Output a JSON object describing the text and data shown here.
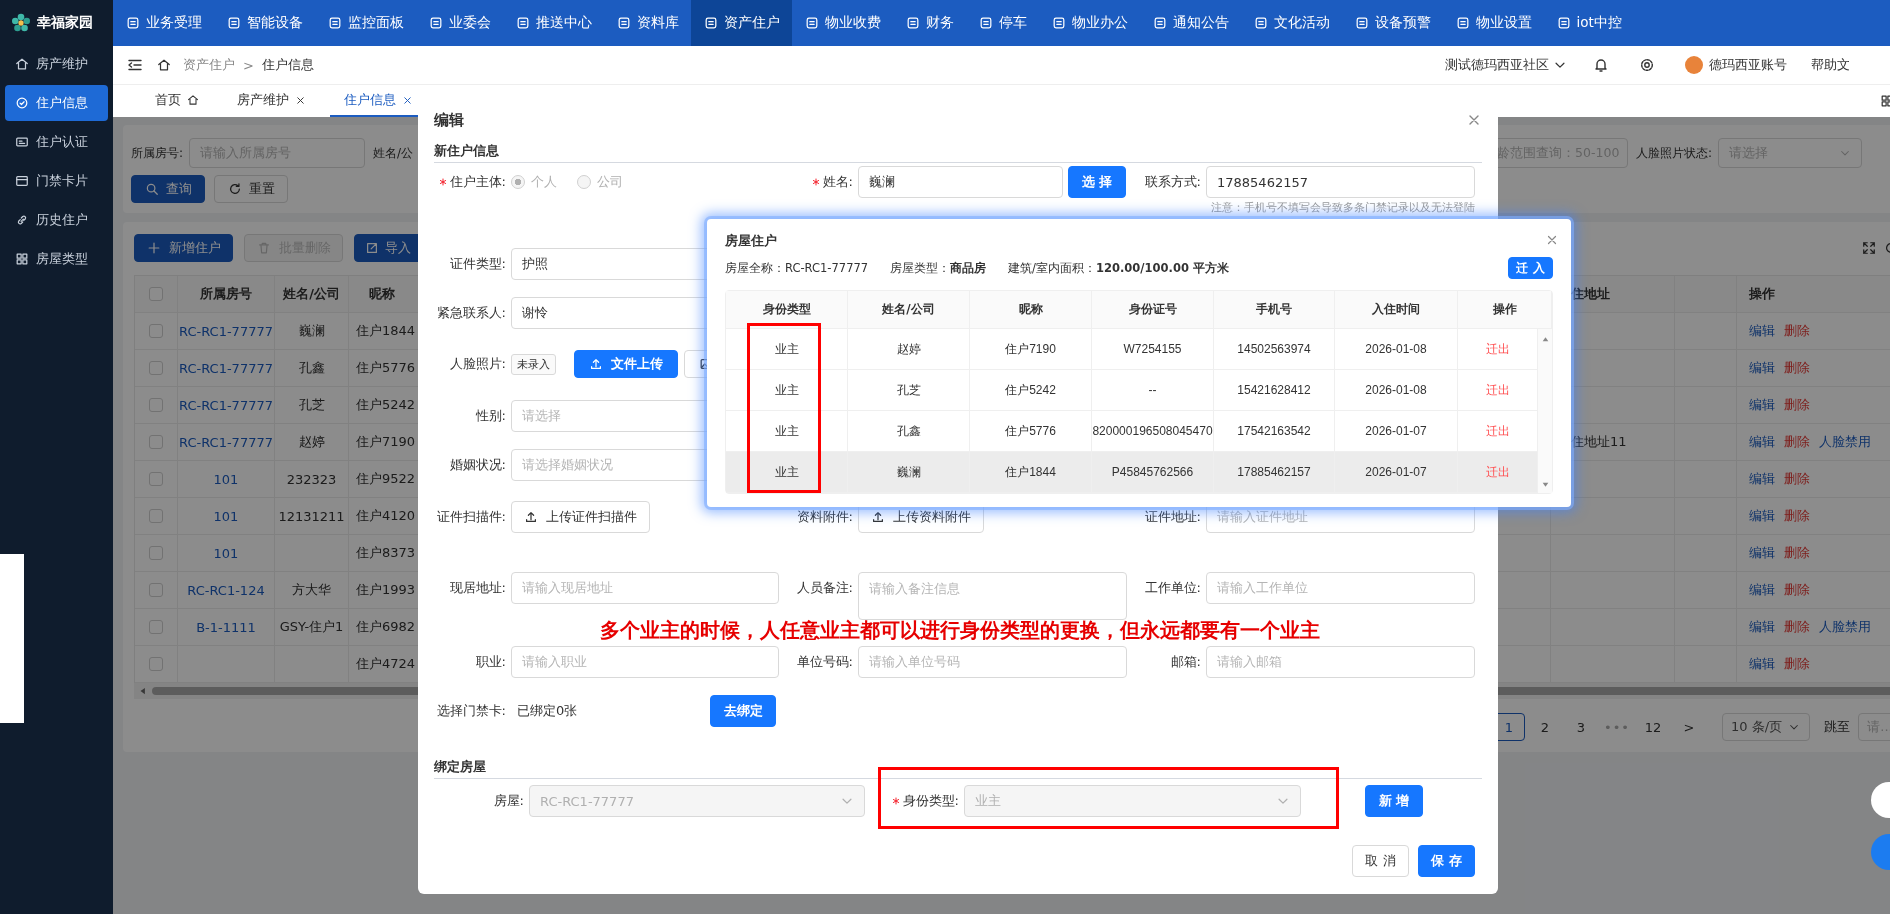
{
  "app": {
    "logo": "幸福家园"
  },
  "top_nav": [
    {
      "label": "业务受理",
      "selected": false
    },
    {
      "label": "智能设备",
      "selected": false
    },
    {
      "label": "监控面板",
      "selected": false
    },
    {
      "label": "业委会",
      "selected": false
    },
    {
      "label": "推送中心",
      "selected": false
    },
    {
      "label": "资料库",
      "selected": false
    },
    {
      "label": "资产住户",
      "selected": true
    },
    {
      "label": "物业收费",
      "selected": false
    },
    {
      "label": "财务",
      "selected": false
    },
    {
      "label": "停车",
      "selected": false
    },
    {
      "label": "物业办公",
      "selected": false
    },
    {
      "label": "通知公告",
      "selected": false
    },
    {
      "label": "文化活动",
      "selected": false
    },
    {
      "label": "设备预警",
      "selected": false
    },
    {
      "label": "物业设置",
      "selected": false
    },
    {
      "label": "iot中控",
      "selected": false
    }
  ],
  "sidebar": {
    "items": [
      {
        "label": "房产维护",
        "selected": false
      },
      {
        "label": "住户信息",
        "selected": true
      },
      {
        "label": "住户认证",
        "selected": false
      },
      {
        "label": "门禁卡片",
        "selected": false
      },
      {
        "label": "历史住户",
        "selected": false
      },
      {
        "label": "房屋类型",
        "selected": false
      }
    ]
  },
  "header": {
    "breadcrumb": [
      "资产住户",
      "住户信息"
    ],
    "separator": ">",
    "community": "测试德玛西亚社区",
    "user": "德玛西亚账号",
    "help": "帮助文"
  },
  "page_tabs": [
    {
      "label": "首页",
      "kind": "home",
      "selected": false
    },
    {
      "label": "房产维护",
      "kind": "closable",
      "selected": false
    },
    {
      "label": "住户信息",
      "kind": "closable",
      "selected": true
    }
  ],
  "search": {
    "room_label": "所属房号:",
    "room_placeholder": "请输入所属房号",
    "name_label": "姓名/公",
    "age_placeholder": "龄范围查询：50-100",
    "face_label": "人脸照片状态:",
    "face_placeholder": "请选择",
    "buttons": [
      {
        "label": "查询",
        "kind": "search"
      },
      {
        "label": "重置",
        "kind": "reset"
      }
    ]
  },
  "toolbar": [
    {
      "label": "新增住户",
      "kind": "add",
      "disabled": false
    },
    {
      "label": "批量删除",
      "kind": "delete",
      "disabled": true
    },
    {
      "label": "导入",
      "kind": "import",
      "disabled": false
    }
  ],
  "table": {
    "header_checked": false,
    "columns": [
      "所属房号",
      "姓名/公司",
      "昵称"
    ],
    "address_column": "住地址",
    "actions_column": "操作",
    "rows": [
      {
        "checked": false,
        "room": "RC-RC1-77777",
        "name": "巍澜",
        "nickname": "住户1844",
        "actions": [
          {
            "label": "编辑",
            "kind": "edit"
          },
          {
            "label": "删除",
            "kind": "delete"
          }
        ]
      },
      {
        "checked": false,
        "room": "RC-RC1-77777",
        "name": "孔鑫",
        "nickname": "住户5776",
        "actions": [
          {
            "label": "编辑",
            "kind": "edit"
          },
          {
            "label": "删除",
            "kind": "delete"
          }
        ]
      },
      {
        "checked": false,
        "room": "RC-RC1-77777",
        "name": "孔芝",
        "nickname": "住户5242",
        "actions": [
          {
            "label": "编辑",
            "kind": "edit"
          },
          {
            "label": "删除",
            "kind": "delete"
          }
        ]
      },
      {
        "checked": false,
        "room": "RC-RC1-77777",
        "name": "赵婷",
        "nickname": "住户7190",
        "address": "住地址11",
        "actions": [
          {
            "label": "编辑",
            "kind": "edit"
          },
          {
            "label": "删除",
            "kind": "delete"
          },
          {
            "label": "人脸禁用",
            "kind": "face"
          }
        ]
      },
      {
        "checked": false,
        "room": "101",
        "name": "232323",
        "nickname": "住户9522",
        "actions": [
          {
            "label": "编辑",
            "kind": "edit"
          },
          {
            "label": "删除",
            "kind": "delete"
          }
        ]
      },
      {
        "checked": false,
        "room": "101",
        "name": "12131211",
        "nickname": "住户4120",
        "actions": [
          {
            "label": "编辑",
            "kind": "edit"
          },
          {
            "label": "删除",
            "kind": "delete"
          }
        ]
      },
      {
        "checked": false,
        "room": "101",
        "nickname": "住户8373",
        "actions": [
          {
            "label": "编辑",
            "kind": "edit"
          },
          {
            "label": "删除",
            "kind": "delete"
          }
        ]
      },
      {
        "checked": false,
        "room": "RC-RC1-124",
        "name": "方大华",
        "nickname": "住户1993",
        "actions": [
          {
            "label": "编辑",
            "kind": "edit"
          },
          {
            "label": "删除",
            "kind": "delete"
          }
        ]
      },
      {
        "checked": false,
        "room": "B-1-1111",
        "name": "GSY-住户1",
        "nickname": "住户6982",
        "actions": [
          {
            "label": "编辑",
            "kind": "edit"
          },
          {
            "label": "删除",
            "kind": "delete"
          },
          {
            "label": "人脸禁用",
            "kind": "face"
          }
        ]
      },
      {
        "checked": false,
        "nickname": "住户4724",
        "actions": [
          {
            "label": "编辑",
            "kind": "edit"
          },
          {
            "label": "删除",
            "kind": "delete"
          }
        ]
      }
    ]
  },
  "pagination": {
    "items": [
      {
        "label": "1",
        "kind": "page",
        "selected": true
      },
      {
        "label": "2",
        "kind": "page",
        "selected": false
      },
      {
        "label": "3",
        "kind": "page",
        "selected": false
      },
      {
        "label": "•••",
        "kind": "ellipsis"
      },
      {
        "label": "12",
        "kind": "page",
        "selected": false
      },
      {
        "label": ">",
        "kind": "next"
      }
    ],
    "page_size": "10 条/页",
    "jump_label": "跳至",
    "jump_placeholder": "请..."
  },
  "edit_modal": {
    "title": "编辑",
    "section": "新住户信息",
    "subject": {
      "label": "住户主体:",
      "required": true,
      "disabled": true,
      "options": [
        {
          "label": "个人",
          "selected": true
        },
        {
          "label": "公司",
          "selected": false
        }
      ]
    },
    "name": {
      "label": "姓名:",
      "required": true,
      "value": "巍澜",
      "button": "选 择"
    },
    "contact": {
      "label": "联系方式:",
      "value": "17885462157",
      "note": "注意：手机号不填写会导致多条门禁记录以及无法登陆"
    },
    "id_type": {
      "label": "证件类型:",
      "value": "护照"
    },
    "emergency": {
      "label": "紧急联系人:",
      "value": "谢怜"
    },
    "face": {
      "label": "人脸照片:",
      "status": "未录入",
      "upload": "文件上传"
    },
    "gender": {
      "label": "性别:",
      "placeholder": "请选择"
    },
    "marital": {
      "label": "婚姻状况:",
      "placeholder": "请选择婚姻状况"
    },
    "scan": {
      "label": "证件扫描件:",
      "button": "上传证件扫描件"
    },
    "attachment": {
      "label": "资料附件:",
      "button": "上传资料附件"
    },
    "id_address": {
      "label": "证件地址:",
      "placeholder": "请输入证件地址"
    },
    "current_address": {
      "label": "现居地址:",
      "placeholder": "请输入现居地址"
    },
    "remark": {
      "label": "人员备注:",
      "placeholder": "请输入备注信息"
    },
    "employer": {
      "label": "工作单位:",
      "placeholder": "请输入工作单位"
    },
    "job": {
      "label": "职业:",
      "placeholder": "请输入职业"
    },
    "unit_no": {
      "label": "单位号码:",
      "placeholder": "请输入单位号码"
    },
    "email": {
      "label": "邮箱:",
      "placeholder": "请输入邮箱"
    },
    "card": {
      "label": "选择门禁卡:",
      "status": "已绑定0张",
      "button": "去绑定"
    },
    "bind_section": "绑定房屋",
    "house": {
      "label": "房屋:",
      "value": "RC-RC1-77777",
      "disabled": true
    },
    "identity": {
      "label": "身份类型:",
      "required": true,
      "value": "业主",
      "disabled": true
    },
    "add_button": "新 增",
    "cancel": "取 消",
    "save": "保 存"
  },
  "house_modal": {
    "title": "房屋住户",
    "info": [
      "房屋全称：RC-RC1-77777",
      "房屋类型：**商品房**",
      "建筑/室内面积：**120.00/100.00 平方米**"
    ],
    "button": "迁 入",
    "columns": [
      "身份类型",
      "姓名/公司",
      "昵称",
      "身份证号",
      "手机号",
      "入住时间",
      "操作"
    ],
    "rows": [
      {
        "identity": "业主",
        "name": "赵婷",
        "nickname": "住户7190",
        "id_no": "W7254155",
        "phone": "14502563974",
        "date": "2026-01-08",
        "action": "迁出",
        "hovered": false
      },
      {
        "identity": "业主",
        "name": "孔芝",
        "nickname": "住户5242",
        "id_no": "--",
        "phone": "15421628412",
        "date": "2026-01-08",
        "action": "迁出",
        "hovered": false
      },
      {
        "identity": "业主",
        "name": "孔鑫",
        "nickname": "住户5776",
        "id_no": "820000196508045470",
        "phone": "17542163542",
        "date": "2026-01-07",
        "action": "迁出",
        "hovered": false
      },
      {
        "identity": "业主",
        "name": "巍澜",
        "nickname": "住户1844",
        "id_no": "P45845762566",
        "phone": "17885462157",
        "date": "2026-01-07",
        "action": "迁出",
        "hovered": true
      }
    ]
  },
  "annotation": {
    "note": "多个业主的时候，人任意业主都可以进行身份类型的更换，但永远都要有一个业主"
  }
}
